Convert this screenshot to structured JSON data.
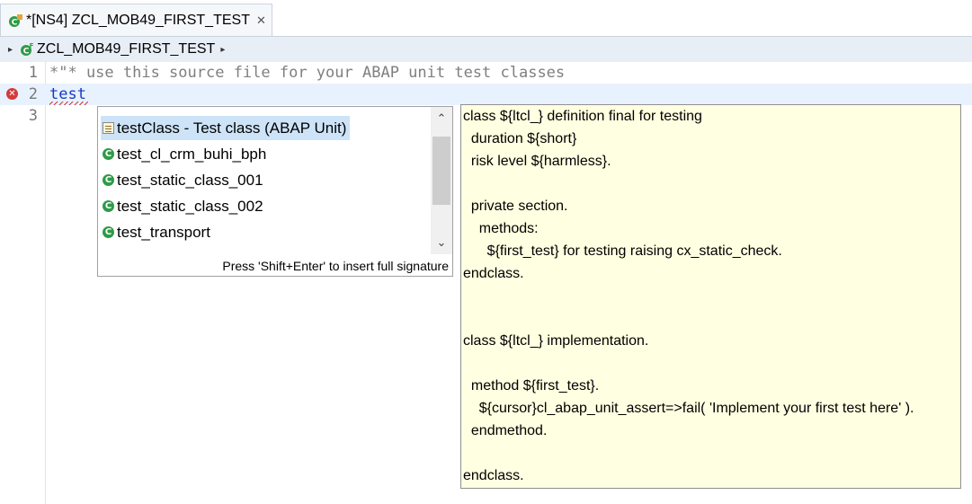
{
  "tab": {
    "title": "*[NS4] ZCL_MOB49_FIRST_TEST",
    "close_glyph": "✕"
  },
  "breadcrumb": {
    "expand_glyph": "▸",
    "class_name": "ZCL_MOB49_FIRST_TEST",
    "more_glyph": "▸"
  },
  "editor": {
    "lines": [
      {
        "number": "1",
        "text": "*\"* use this source file for your ABAP unit test classes"
      },
      {
        "number": "2",
        "text": "test",
        "error": true
      },
      {
        "number": "3",
        "text": ""
      }
    ]
  },
  "completion": {
    "items": [
      {
        "label": "testClass - Test class (ABAP Unit)",
        "icon": "template-icon",
        "selected": true
      },
      {
        "label": "test_cl_crm_buhi_bph",
        "icon": "class-icon"
      },
      {
        "label": "test_static_class_001",
        "icon": "class-icon"
      },
      {
        "label": "test_static_class_002",
        "icon": "class-icon"
      },
      {
        "label": "test_transport",
        "icon": "class-icon"
      }
    ],
    "status": "Press 'Shift+Enter' to insert full signature",
    "scroll_up": "⌃",
    "scroll_down": "⌄"
  },
  "info": {
    "lines": [
      "class ${ltcl_} definition final for testing",
      "  duration ${short}",
      "  risk level ${harmless}.",
      "",
      "  private section.",
      "    methods:",
      "      ${first_test} for testing raising cx_static_check.",
      "endclass.",
      "",
      "",
      "class ${ltcl_} implementation.",
      "",
      "  method ${first_test}.",
      "    ${cursor}cl_abap_unit_assert=>fail( 'Implement your first test here' ).",
      "  endmethod.",
      "",
      "endclass."
    ]
  },
  "colors": {
    "keyword": "#1a37c9",
    "comment": "#7f7f7f",
    "error": "#d43a3a",
    "class_icon": "#2e9b47",
    "info_bg": "#ffffe1",
    "selection": "#cde3f7"
  }
}
